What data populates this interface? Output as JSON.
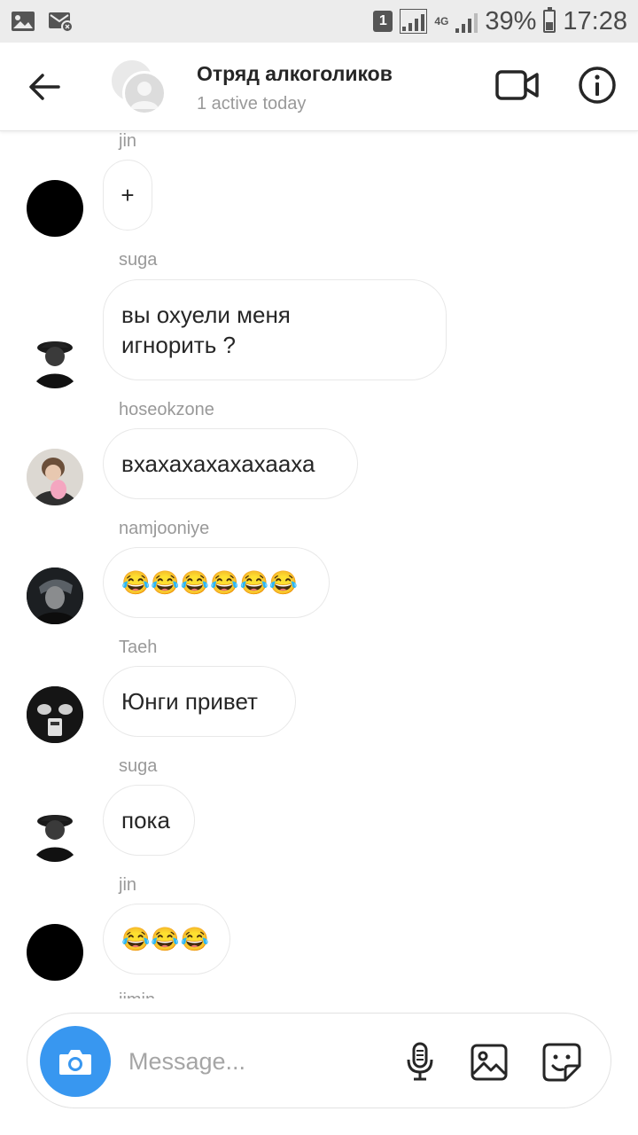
{
  "status_bar": {
    "sim_slot": "1",
    "network": "4G",
    "battery": "39%",
    "battery_level": 0.39,
    "time": "17:28"
  },
  "header": {
    "title": "Отряд алкоголиков",
    "subtitle": "1 active today"
  },
  "messages": [
    {
      "sender": "jin",
      "text": "+"
    },
    {
      "sender": "suga",
      "text": "вы охуели меня\nигнорить ?"
    },
    {
      "sender": "hoseokzone",
      "text": "вхахахахахахааха"
    },
    {
      "sender": "namjooniye",
      "text": "😂😂😂😂😂😂"
    },
    {
      "sender": "Taeh",
      "text": "Юнги привет"
    },
    {
      "sender": "suga",
      "text": "пока"
    },
    {
      "sender": "jin",
      "text": "😂😂😂"
    },
    {
      "sender": "jimin",
      "text": ""
    }
  ],
  "composer": {
    "placeholder": "Message..."
  },
  "colors": {
    "accent": "#3897f0",
    "bubble_border": "#e8e8e8",
    "muted_text": "#999999"
  }
}
